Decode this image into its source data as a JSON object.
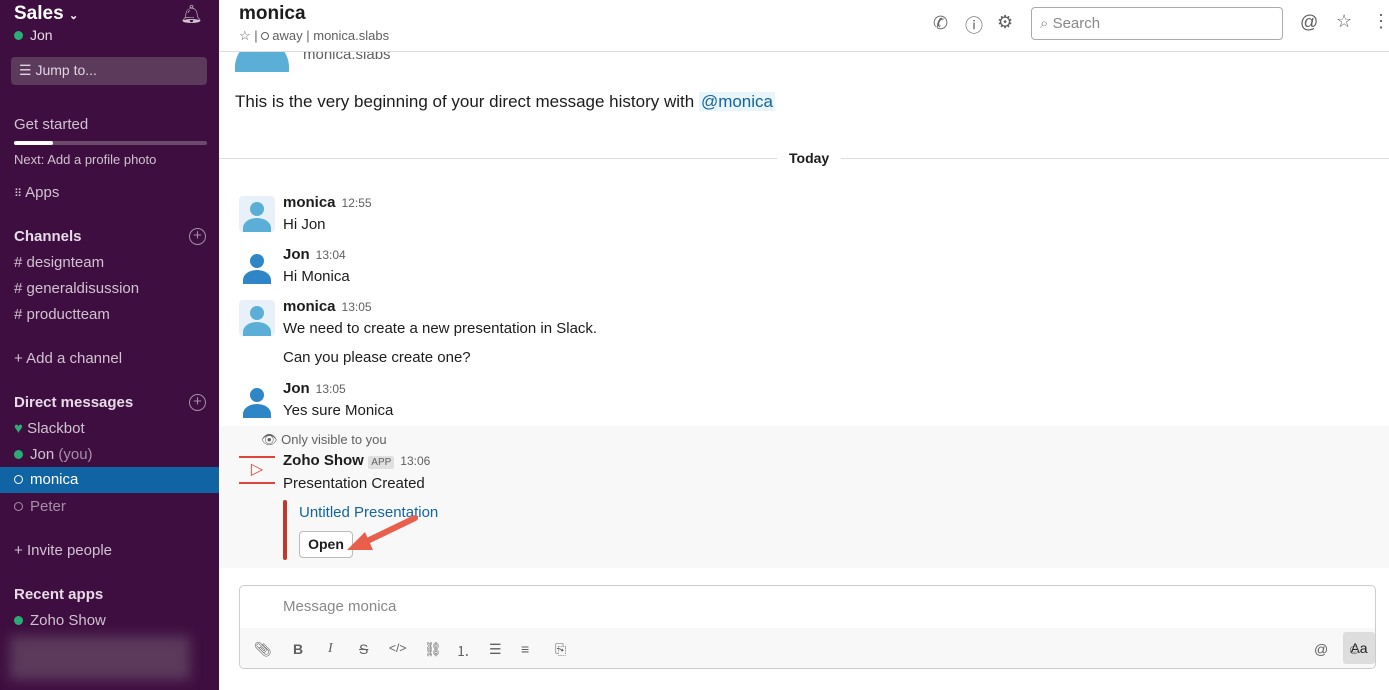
{
  "sidebar": {
    "team": "Sales",
    "user": "Jon",
    "jump": "Jump to...",
    "get_started": "Get started",
    "progress": 0.2,
    "next": "Next: Add a profile photo",
    "apps": "Apps",
    "channels_title": "Channels",
    "channels": [
      "designteam",
      "generaldisussion",
      "productteam"
    ],
    "add_channel": "Add a channel",
    "dm_title": "Direct messages",
    "dms": [
      "Slackbot",
      "Jon",
      "monica",
      "Peter"
    ],
    "you": "(you)",
    "invite": "Invite people",
    "recent_title": "Recent apps",
    "recent": [
      "Zoho Show"
    ]
  },
  "header": {
    "title": "monica",
    "status": "away",
    "handle": "monica.slabs",
    "search_placeholder": "Search"
  },
  "intro": {
    "handle": "monica.slabs",
    "text": "This is the very beginning of your direct message history with ",
    "mention": "@monica"
  },
  "divider": "Today",
  "messages": [
    {
      "name": "monica",
      "time": "12:55",
      "lines": [
        "Hi Jon"
      ]
    },
    {
      "name": "Jon",
      "time": "13:04",
      "lines": [
        "Hi Monica"
      ]
    },
    {
      "name": "monica",
      "time": "13:05",
      "lines": [
        "We need to create a new presentation in Slack.",
        "Can you please create one?"
      ]
    },
    {
      "name": "Jon",
      "time": "13:05",
      "lines": [
        "Yes sure Monica"
      ]
    }
  ],
  "app_msg": {
    "visibility": "Only visible to you",
    "name": "Zoho Show",
    "badge": "APP",
    "time": "13:06",
    "text": "Presentation Created",
    "link": "Untitled Presentation",
    "button": "Open"
  },
  "composer": {
    "placeholder": "Message monica",
    "aa": "Aa"
  }
}
